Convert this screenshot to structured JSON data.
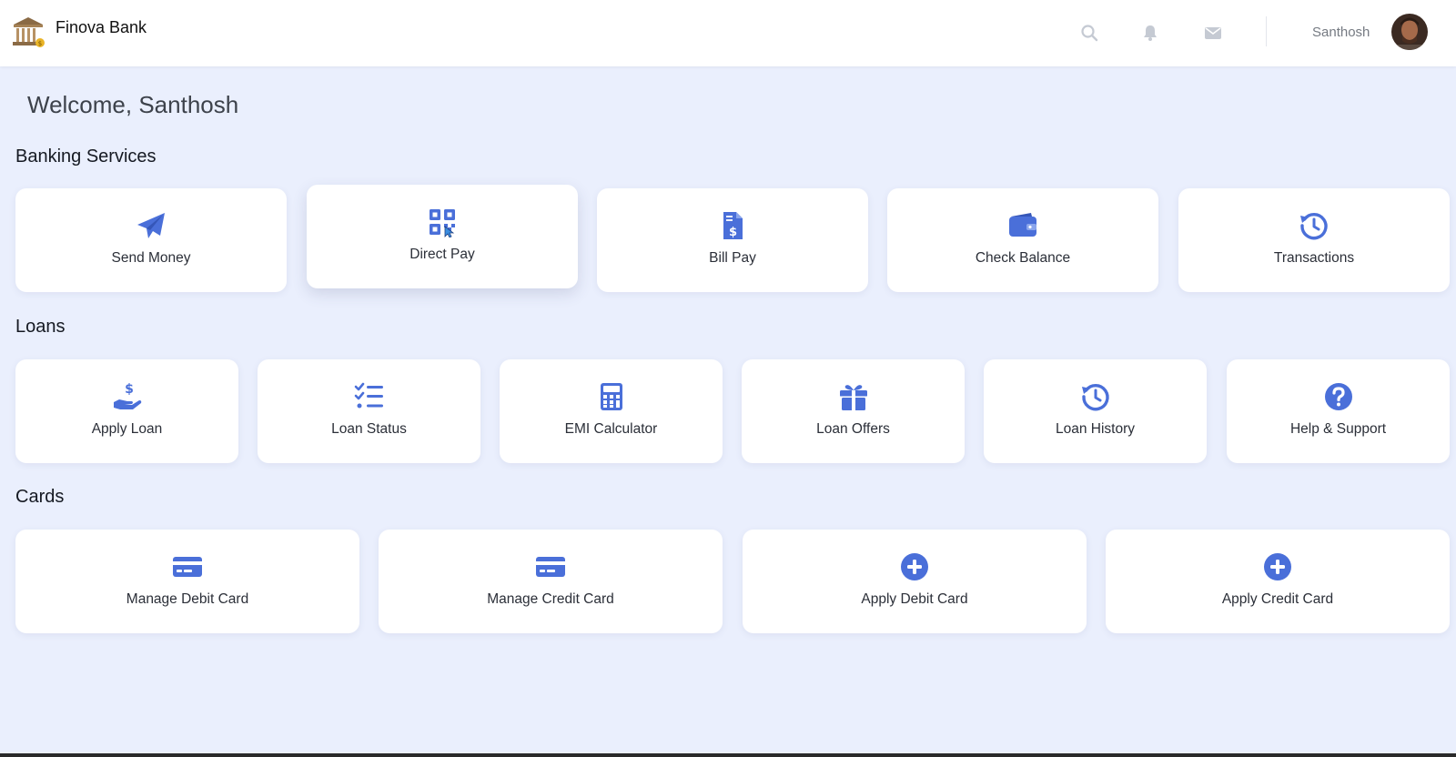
{
  "header": {
    "brand_name": "Finova Bank",
    "username": "Santhosh",
    "icons": [
      "bank-logo-icon",
      "search-icon",
      "bell-icon",
      "envelope-icon",
      "avatar"
    ]
  },
  "welcome": "Welcome, Santhosh",
  "sections": {
    "banking": {
      "title": "Banking Services",
      "items": [
        {
          "label": "Send Money",
          "icon": "paper-plane-icon"
        },
        {
          "label": "Direct Pay",
          "icon": "qr-code-icon"
        },
        {
          "label": "Bill Pay",
          "icon": "bill-dollar-icon"
        },
        {
          "label": "Check Balance",
          "icon": "wallet-icon"
        },
        {
          "label": "Transactions",
          "icon": "history-icon"
        }
      ]
    },
    "loans": {
      "title": "Loans",
      "items": [
        {
          "label": "Apply Loan",
          "icon": "hand-dollar-icon"
        },
        {
          "label": "Loan Status",
          "icon": "checklist-icon"
        },
        {
          "label": "EMI Calculator",
          "icon": "calculator-icon"
        },
        {
          "label": "Loan Offers",
          "icon": "gift-icon"
        },
        {
          "label": "Loan History",
          "icon": "history-icon"
        },
        {
          "label": "Help & Support",
          "icon": "question-circle-icon"
        }
      ]
    },
    "cards": {
      "title": "Cards",
      "items": [
        {
          "label": "Manage Debit Card",
          "icon": "credit-card-icon"
        },
        {
          "label": "Manage Credit Card",
          "icon": "credit-card-icon"
        },
        {
          "label": "Apply Debit Card",
          "icon": "plus-circle-icon"
        },
        {
          "label": "Apply Credit Card",
          "icon": "plus-circle-icon"
        }
      ]
    }
  },
  "colors": {
    "accent": "#4a6fd9",
    "background": "#eaeffd",
    "card": "#ffffff",
    "header_icons": "#c5cad3"
  }
}
